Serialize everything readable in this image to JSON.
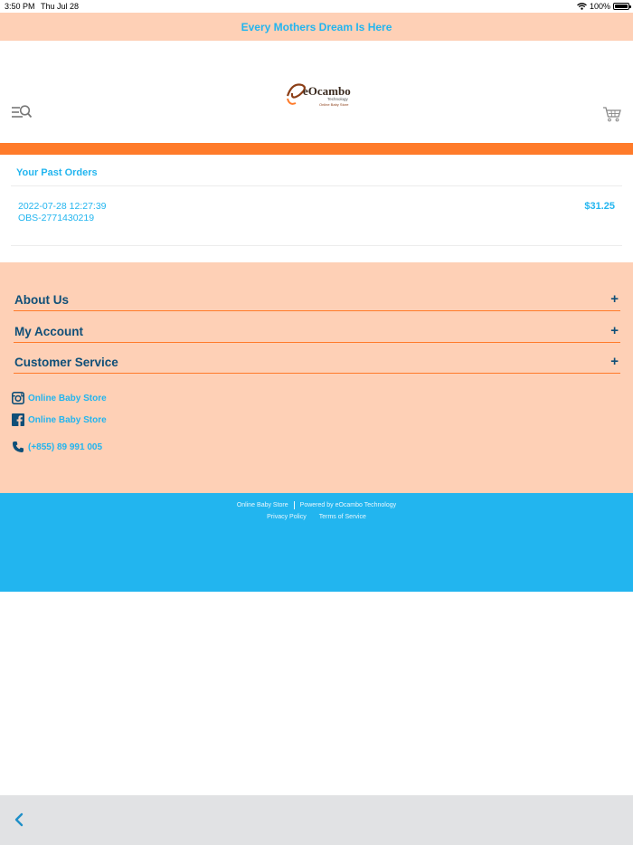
{
  "status_bar": {
    "time": "3:50 PM",
    "date": "Thu Jul 28",
    "battery": "100%"
  },
  "promo": {
    "text": "Every Mothers Dream Is Here"
  },
  "header": {
    "logo": {
      "brand": "eOcambo",
      "sub1": "Technology",
      "sub2": "Online Baby Store"
    },
    "menu_icon": "menu-search-icon",
    "cart_icon": "cart-icon"
  },
  "orders": {
    "title": "Your Past Orders",
    "items": [
      {
        "date": "2022-07-28 12:27:39",
        "id": "OBS-2771430219",
        "total": "$31.25"
      }
    ]
  },
  "footer": {
    "sections": [
      {
        "label": "About Us",
        "icon": "+"
      },
      {
        "label": "My Account",
        "icon": "+"
      },
      {
        "label": "Customer Service",
        "icon": "+"
      }
    ],
    "instagram": "Online Baby Store",
    "facebook": "Online Baby Store",
    "phone": "(+855) 89 991 005"
  },
  "bottom_footer": {
    "store": "Online Baby Store",
    "powered": "Powered by eOcambo Technology",
    "privacy": "Privacy Policy",
    "terms": "Terms of Service"
  },
  "colors": {
    "peach": "#fed0b6",
    "orange": "#ff7b2a",
    "blue": "#22b5ef",
    "navy": "#0f4f78"
  }
}
